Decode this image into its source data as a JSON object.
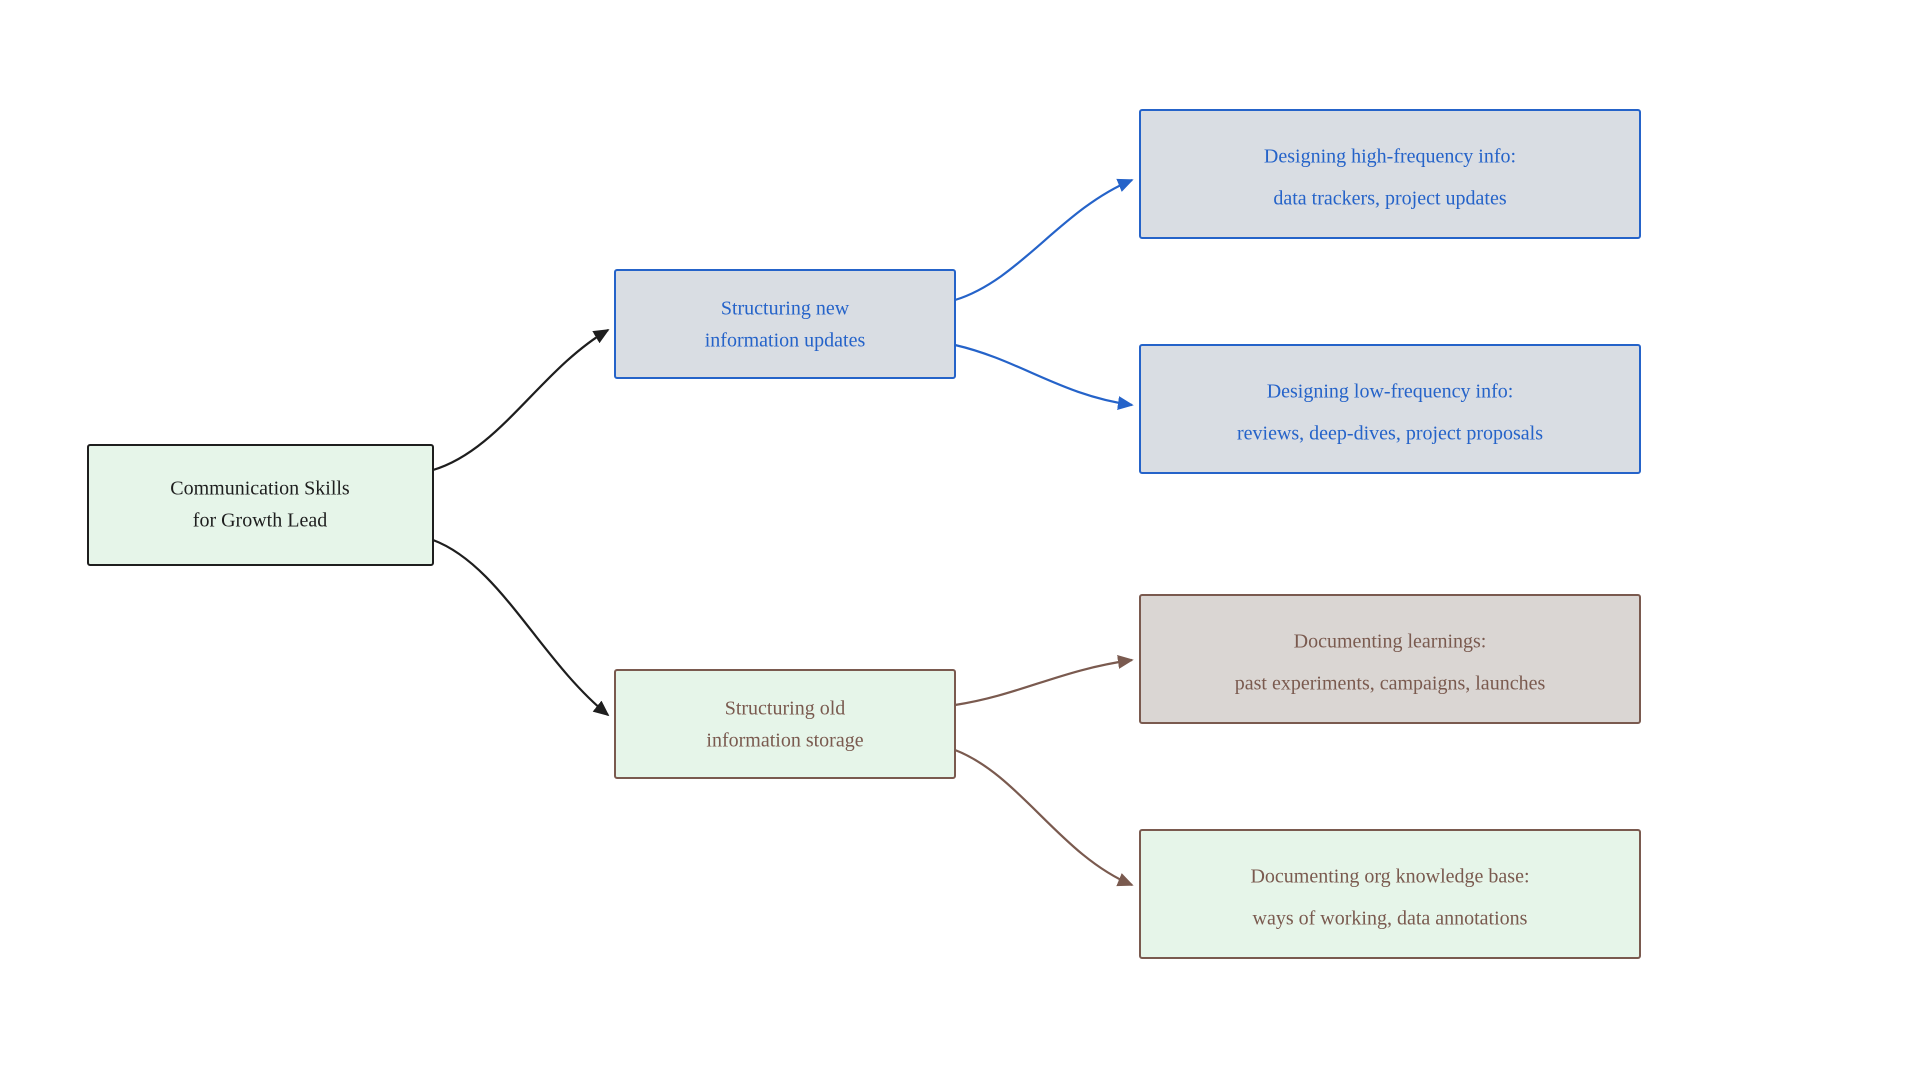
{
  "root": {
    "line1": "Communication Skills",
    "line2": "for Growth Lead"
  },
  "branch_new": {
    "line1": "Structuring new",
    "line2": "information updates"
  },
  "branch_old": {
    "line1": "Structuring old",
    "line2": "information storage"
  },
  "leaf_hf": {
    "line1": "Designing high-frequency info:",
    "line2": "data trackers, project updates"
  },
  "leaf_lf": {
    "line1": "Designing low-frequency info:",
    "line2": "reviews, deep-dives, project proposals"
  },
  "leaf_learn": {
    "line1": "Documenting learnings:",
    "line2": "past experiments, campaigns, launches"
  },
  "leaf_kb": {
    "line1": "Documenting org knowledge base:",
    "line2": "ways of working, data annotations"
  },
  "colors": {
    "root_fill": "#e6f5e9",
    "root_stroke": "#1e1e1e",
    "root_text": "#1e1e1e",
    "blue_fill": "#d9dde3",
    "blue_stroke": "#2563c9",
    "blue_text": "#2563c9",
    "brown_fill_grey": "#dad6d3",
    "brown_fill_green": "#e6f5e9",
    "brown_stroke": "#7a5a4f",
    "brown_text": "#7a5a4f",
    "arrow_black": "#1e1e1e",
    "arrow_blue": "#2563c9",
    "arrow_brown": "#7a5a4f"
  }
}
